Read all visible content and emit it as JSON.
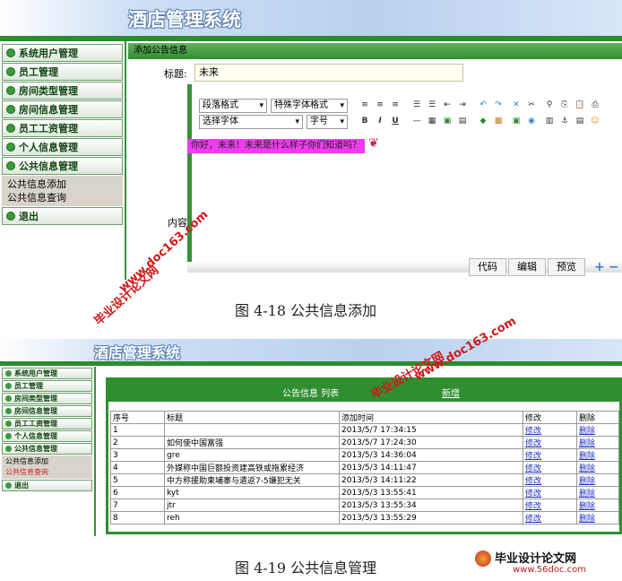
{
  "app": {
    "title": "酒店管理系统"
  },
  "menu": [
    {
      "label": "系统用户管理"
    },
    {
      "label": "员工管理"
    },
    {
      "label": "房间类型管理"
    },
    {
      "label": "房间信息管理"
    },
    {
      "label": "员工工资管理"
    },
    {
      "label": "个人信息管理"
    },
    {
      "label": "公共信息管理"
    }
  ],
  "submenu": [
    "公共信息添加",
    "公共信息查询"
  ],
  "exit_label": "退出",
  "form": {
    "header": "添加公告信息",
    "title_label": "标题:",
    "title_value": "未来",
    "content_label": "内容",
    "editor_text": "你好，未来！未来是什么样子你们知道吗？",
    "dropdowns": [
      "段落格式",
      "特殊字体格式",
      "选择字体",
      "字号"
    ],
    "tabs": [
      "代码",
      "编辑",
      "预览"
    ]
  },
  "captions": {
    "fig1": "图 4-18 公共信息添加",
    "fig2": "图 4-19 公共信息管理"
  },
  "list": {
    "header": "公告信息  列表",
    "add_link": "新增",
    "columns": [
      "序号",
      "标题",
      "添加时间",
      "修改",
      "删除"
    ],
    "rows": [
      [
        "1",
        "",
        "2013/5/7 17:34:15",
        "修改",
        "删除"
      ],
      [
        "2",
        "如何使中国富强",
        "2013/5/7 17:24:30",
        "修改",
        "删除"
      ],
      [
        "3",
        "gre",
        "2013/5/3 14:36:04",
        "修改",
        "删除"
      ],
      [
        "4",
        "外媒称中国巨额投资建高铁或拖累经济",
        "2013/5/3 14:11:47",
        "修改",
        "删除"
      ],
      [
        "5",
        "中方称援助柬埔寨与遣返7-5嫌犯无关",
        "2013/5/3 14:11:22",
        "修改",
        "删除"
      ],
      [
        "6",
        "kyt",
        "2013/5/3 13:55:41",
        "修改",
        "删除"
      ],
      [
        "7",
        "jtr",
        "2013/5/3 13:55:34",
        "修改",
        "删除"
      ],
      [
        "8",
        "reh",
        "2013/5/3 13:55:29",
        "修改",
        "删除"
      ]
    ]
  },
  "watermarks": [
    "毕业设计论文网",
    "www.doc163.com"
  ],
  "footer_logo": {
    "name": "毕业设计论文网",
    "url": "www.56doc.com"
  }
}
